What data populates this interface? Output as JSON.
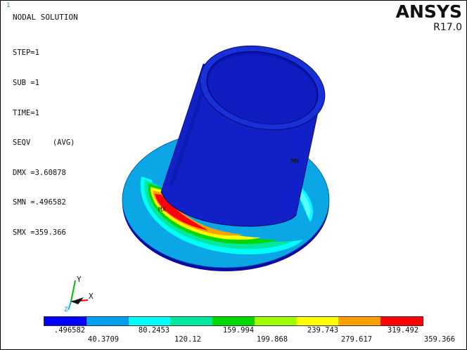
{
  "window_number": "1",
  "info": {
    "title": "NODAL SOLUTION",
    "lines": [
      "STEP=1",
      "SUB =1",
      "TIME=1",
      "SEQV     (AVG)",
      "DMX =3.60878",
      "SMN =.496582",
      "SMX =359.366"
    ]
  },
  "logo": {
    "name": "ANSYS",
    "release": "R17.0"
  },
  "model": {
    "max_marker": "MX",
    "min_marker": "MN"
  },
  "triad": {
    "x_label": "X",
    "y_label": "Y",
    "z_label": "Z"
  },
  "legend": {
    "colors": [
      "#0000ff",
      "#00a0f0",
      "#00ffff",
      "#00e8a0",
      "#00d800",
      "#a0ff00",
      "#ffff00",
      "#ffa000",
      "#ff0000"
    ],
    "top_labels": [
      ".496582",
      "80.2453",
      "159.994",
      "239.743",
      "319.492"
    ],
    "bottom_labels": [
      "40.3709",
      "120.12",
      "199.868",
      "279.617",
      "359.366"
    ]
  }
}
